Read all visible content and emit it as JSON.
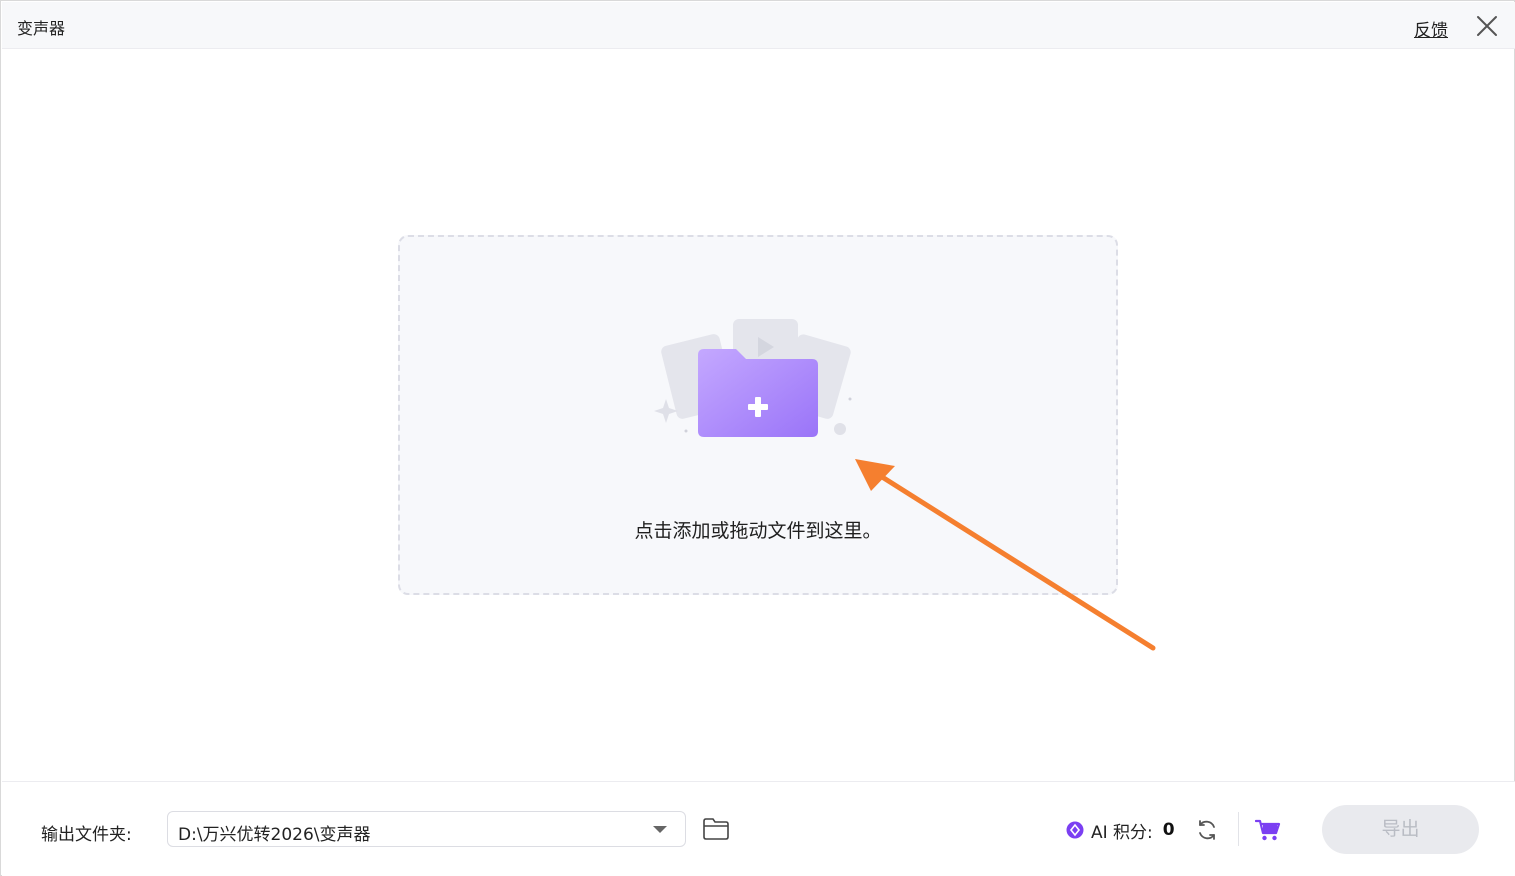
{
  "window": {
    "title": "变声器"
  },
  "header": {
    "feedback_label": "反馈",
    "close_icon": "close-icon"
  },
  "dropzone": {
    "text": "点击添加或拖动文件到这里。",
    "icon": "add-folder-icon"
  },
  "annotation": {
    "icon": "arrow-icon",
    "color": "#f57f2f"
  },
  "footer": {
    "output_label": "输出文件夹:",
    "output_path": "D:\\万兴优转2026\\变声器",
    "ai_label": "AI 积分:",
    "ai_value": "0",
    "export_label": "导出"
  },
  "colors": {
    "accent": "#8b5cf6",
    "export_disabled_bg": "#e9eaee",
    "export_disabled_text": "#b9bcc4"
  }
}
